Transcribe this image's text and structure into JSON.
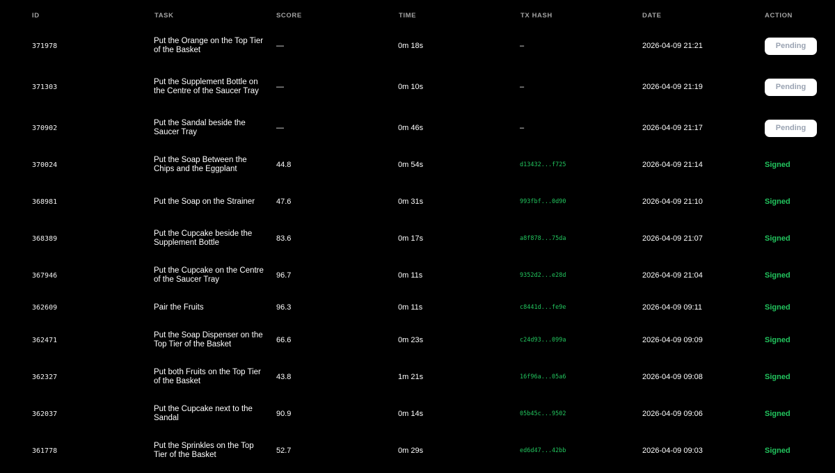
{
  "columns": {
    "id": "ID",
    "task": "TASK",
    "score": "SCORE",
    "time": "TIME",
    "tx_hash": "TX HASH",
    "date": "DATE",
    "action": "ACTION"
  },
  "colors": {
    "background": "#000000",
    "header_text": "#a3a3a3",
    "signed": "#22c55e",
    "pending_button_bg": "#ffffff",
    "pending_button_text": "#9aa3b2"
  },
  "rows": [
    {
      "id": "371978",
      "task": "Put the Orange on the Top Tier of the Basket",
      "score": "—",
      "time": "0m 18s",
      "tx_hash": "–",
      "date": "2026-04-09 21:21",
      "action": "Pending",
      "status": "pending"
    },
    {
      "id": "371303",
      "task": "Put the Supplement Bottle on the Centre of the Saucer Tray",
      "score": "—",
      "time": "0m 10s",
      "tx_hash": "–",
      "date": "2026-04-09 21:19",
      "action": "Pending",
      "status": "pending"
    },
    {
      "id": "370902",
      "task": "Put the Sandal beside the Saucer Tray",
      "score": "—",
      "time": "0m 46s",
      "tx_hash": "–",
      "date": "2026-04-09 21:17",
      "action": "Pending",
      "status": "pending"
    },
    {
      "id": "370024",
      "task": "Put the Soap Between the Chips and the Eggplant",
      "score": "44.8",
      "time": "0m 54s",
      "tx_hash": "d13432...f725",
      "date": "2026-04-09 21:14",
      "action": "Signed",
      "status": "signed"
    },
    {
      "id": "368981",
      "task": "Put the Soap on the Strainer",
      "score": "47.6",
      "time": "0m 31s",
      "tx_hash": "993fbf...0d90",
      "date": "2026-04-09 21:10",
      "action": "Signed",
      "status": "signed"
    },
    {
      "id": "368389",
      "task": "Put the Cupcake beside the Supplement Bottle",
      "score": "83.6",
      "time": "0m 17s",
      "tx_hash": "a8f878...75da",
      "date": "2026-04-09 21:07",
      "action": "Signed",
      "status": "signed"
    },
    {
      "id": "367946",
      "task": "Put the Cupcake on the Centre of the Saucer Tray",
      "score": "96.7",
      "time": "0m 11s",
      "tx_hash": "9352d2...e28d",
      "date": "2026-04-09 21:04",
      "action": "Signed",
      "status": "signed"
    },
    {
      "id": "362609",
      "task": "Pair the Fruits",
      "score": "96.3",
      "time": "0m 11s",
      "tx_hash": "c8441d...fe9e",
      "date": "2026-04-09 09:11",
      "action": "Signed",
      "status": "signed"
    },
    {
      "id": "362471",
      "task": "Put the Soap Dispenser on the Top Tier of the Basket",
      "score": "66.6",
      "time": "0m 23s",
      "tx_hash": "c24d93...099a",
      "date": "2026-04-09 09:09",
      "action": "Signed",
      "status": "signed"
    },
    {
      "id": "362327",
      "task": "Put both Fruits on the Top Tier of the Basket",
      "score": "43.8",
      "time": "1m 21s",
      "tx_hash": "16f96a...05a6",
      "date": "2026-04-09 09:08",
      "action": "Signed",
      "status": "signed"
    },
    {
      "id": "362037",
      "task": "Put the Cupcake next to the Sandal",
      "score": "90.9",
      "time": "0m 14s",
      "tx_hash": "05b45c...9502",
      "date": "2026-04-09 09:06",
      "action": "Signed",
      "status": "signed"
    },
    {
      "id": "361778",
      "task": "Put the Sprinkles on the Top Tier of the Basket",
      "score": "52.7",
      "time": "0m 29s",
      "tx_hash": "ed6d47...42bb",
      "date": "2026-04-09 09:03",
      "action": "Signed",
      "status": "signed"
    }
  ]
}
